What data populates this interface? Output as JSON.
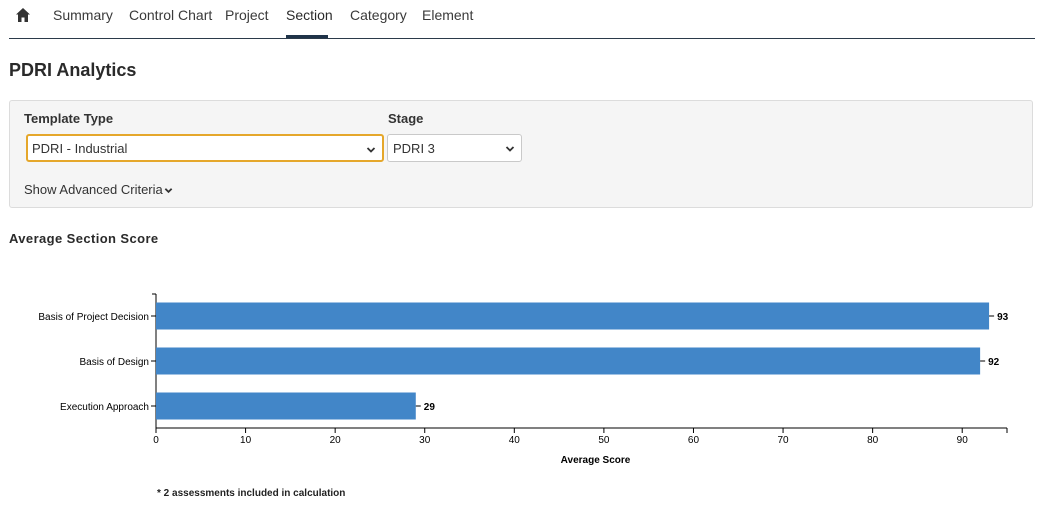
{
  "nav": {
    "home_icon": "home-icon",
    "tabs": [
      {
        "label": "Summary",
        "active": false
      },
      {
        "label": "Control Chart",
        "active": false
      },
      {
        "label": "Project",
        "active": false
      },
      {
        "label": "Section",
        "active": true
      },
      {
        "label": "Category",
        "active": false
      },
      {
        "label": "Element",
        "active": false
      }
    ]
  },
  "page": {
    "title": "PDRI Analytics"
  },
  "filters": {
    "template_type": {
      "label": "Template Type",
      "value": "PDRI - Industrial"
    },
    "stage": {
      "label": "Stage",
      "value": "PDRI 3"
    },
    "advanced_label": "Show Advanced Criteria"
  },
  "chart_section": {
    "title": "Average Section Score"
  },
  "chart_data": {
    "type": "bar",
    "orientation": "horizontal",
    "categories": [
      "Basis of Project Decision",
      "Basis of Design",
      "Execution Approach"
    ],
    "values": [
      93,
      92,
      29
    ],
    "xlabel": "Average Score",
    "ylabel": "",
    "xlim": [
      0,
      95
    ],
    "xticks": [
      0,
      10,
      20,
      30,
      40,
      50,
      60,
      70,
      80,
      90
    ],
    "grid": false,
    "bar_color": "#4286c8"
  },
  "footnote": "* 2 assessments included in calculation",
  "colors": {
    "accent_focus": "#e5a72b",
    "nav_underline": "#1f3349",
    "bar": "#4286c8"
  }
}
